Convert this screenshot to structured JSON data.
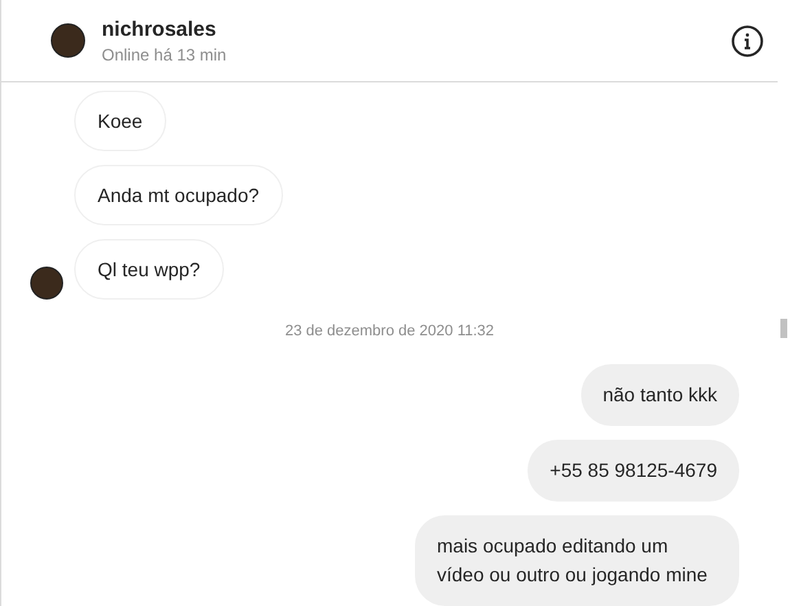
{
  "header": {
    "username": "nichrosales",
    "status": "Online há 13 min"
  },
  "messages": [
    {
      "kind": "incoming",
      "text": "Koee",
      "avatar": false
    },
    {
      "kind": "incoming",
      "text": "Anda mt ocupado?",
      "avatar": false
    },
    {
      "kind": "incoming",
      "text": "Ql teu wpp?",
      "avatar": true
    },
    {
      "kind": "timestamp",
      "text": "23 de dezembro de 2020 11:32"
    },
    {
      "kind": "outgoing",
      "text": "não tanto kkk"
    },
    {
      "kind": "outgoing",
      "text": "+55 85 98125-4679"
    },
    {
      "kind": "outgoing",
      "text": "mais ocupado editando um vídeo ou outro ou jogando mine"
    }
  ]
}
